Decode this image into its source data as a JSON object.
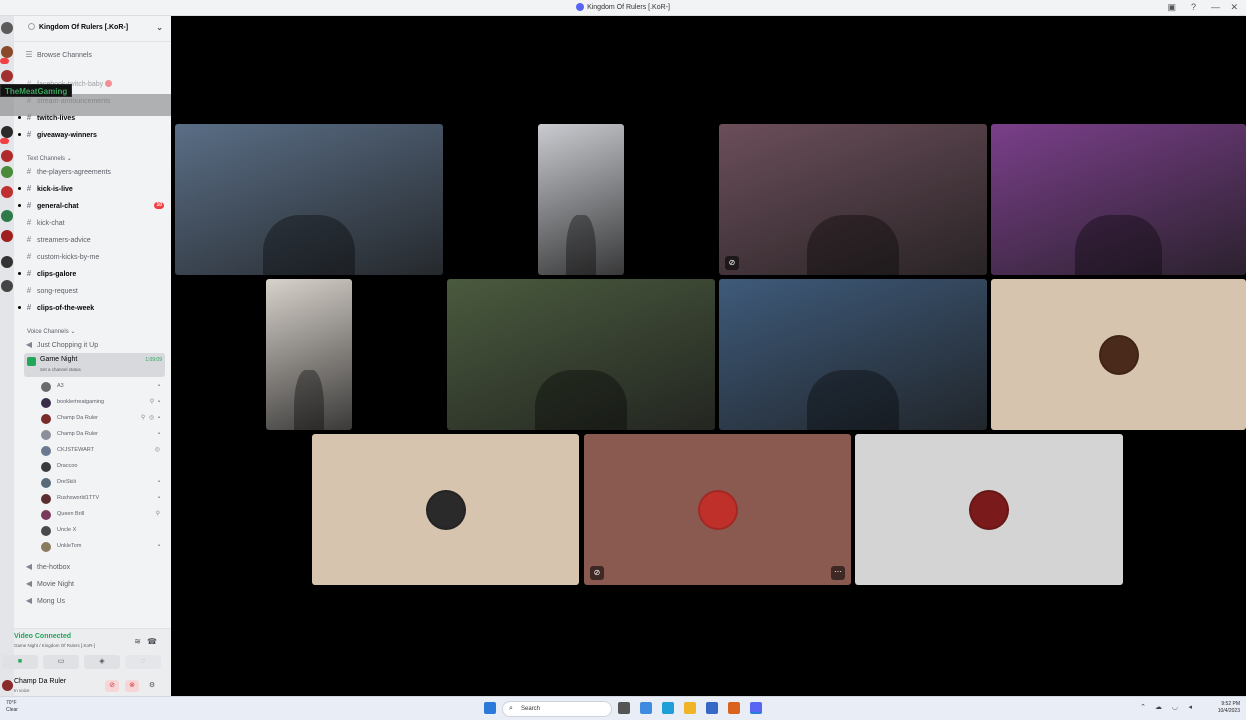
{
  "window": {
    "title": "Kingdom Of Rulers [.KoR-]"
  },
  "server": {
    "name": "Kingdom Of Rulers [.KoR-]"
  },
  "overlay": {
    "streamer_tag": "TheMeatGaming"
  },
  "sidebar": {
    "browse": "Browse Channels",
    "top_channels": [
      {
        "name": "facebook-twitch-baby",
        "bold": false
      },
      {
        "name": "stream-announcements",
        "bold": false
      },
      {
        "name": "twitch-lives",
        "bold": true
      },
      {
        "name": "giveaway-winners",
        "bold": true
      }
    ],
    "text_category": "Text Channels",
    "text_channels": [
      {
        "name": "the-players-agreements",
        "bold": false,
        "badge": ""
      },
      {
        "name": "kick-is-live",
        "bold": true,
        "badge": ""
      },
      {
        "name": "general-chat",
        "bold": true,
        "badge": "10"
      },
      {
        "name": "kick-chat",
        "bold": false,
        "badge": ""
      },
      {
        "name": "streamers-advice",
        "bold": false,
        "badge": ""
      },
      {
        "name": "custom-kicks-by-me",
        "bold": false,
        "badge": ""
      },
      {
        "name": "clips-galore",
        "bold": true,
        "badge": ""
      },
      {
        "name": "song-request",
        "bold": false,
        "badge": ""
      },
      {
        "name": "clips-of-the-week",
        "bold": true,
        "badge": ""
      }
    ],
    "voice_category": "Voice Channels",
    "voice_top": "Just Chopping it Up",
    "active_voice": {
      "name": "Game Night",
      "status": "Set a channel status",
      "time": "1:09:09"
    },
    "voice_users": [
      {
        "name": "A3",
        "color": "#6b6b6b",
        "tail": "▪"
      },
      {
        "name": "booklertreatgaming",
        "color": "#3a2f4a",
        "tail": "⚲ ▪"
      },
      {
        "name": "Champ Da Ruler",
        "color": "#7a2a2a",
        "tail": "⚲ ◎ ▪"
      },
      {
        "name": "Champ Da Ruler",
        "color": "#8a8f99",
        "tail": "▪"
      },
      {
        "name": "CKJSTEWART",
        "color": "#6b7a90",
        "tail": "◎"
      },
      {
        "name": "Draccoo",
        "color": "#3a3a3a",
        "tail": ""
      },
      {
        "name": "DreSkiii",
        "color": "#566a7a",
        "tail": "▪"
      },
      {
        "name": "Rushsworld1TTV",
        "color": "#5a2f2f",
        "tail": "▪"
      },
      {
        "name": "Queen Brill",
        "color": "#7a3a5a",
        "tail": "⚲"
      },
      {
        "name": "Uncle X",
        "color": "#4a4a4a",
        "tail": ""
      },
      {
        "name": "UnkleTom",
        "color": "#8a7a60",
        "tail": "▪"
      }
    ],
    "more_voice": [
      "the-hotbox",
      "Movie Night",
      "Mong Us"
    ]
  },
  "voice_panel": {
    "status": "Video Connected",
    "channel": "Game Night / Kingdom Of Rulers [.KoR-]"
  },
  "user_panel": {
    "name": "Champ Da Ruler",
    "status": "In voice"
  },
  "stage_tiles": [
    {
      "kind": "video",
      "color": "#5a6e86",
      "corner": "",
      "avatar": ""
    },
    {
      "kind": "video",
      "color": "#c9cbd0",
      "corner": "",
      "avatar": ""
    },
    {
      "kind": "video",
      "color": "#6b4e5a",
      "corner": "⊘",
      "avatar": ""
    },
    {
      "kind": "video",
      "color": "#7a3f8a",
      "corner": "",
      "avatar": ""
    },
    {
      "kind": "video",
      "color": "#d8d2cb",
      "corner": "",
      "avatar": ""
    },
    {
      "kind": "video",
      "color": "#4a5a3e",
      "corner": "",
      "avatar": ""
    },
    {
      "kind": "video",
      "color": "#3e5a7a",
      "corner": "",
      "avatar": ""
    },
    {
      "kind": "avatar",
      "color": "#d6c4ae",
      "corner": "",
      "avatar": "#4a2a1a"
    },
    {
      "kind": "avatar",
      "color": "#d6c4ae",
      "corner": "",
      "avatar": "#2a2a2a"
    },
    {
      "kind": "avatar",
      "color": "#8a5a50",
      "corner": "⊘",
      "avatar": "#c0302a",
      "more": "⋯"
    },
    {
      "kind": "avatar",
      "color": "#d4d4d4",
      "corner": "",
      "avatar": "#7a1a1a"
    }
  ],
  "taskbar": {
    "weather_temp": "70°F",
    "weather_desc": "Clear",
    "search": "Search",
    "time": "9:52 PM",
    "date": "10/4/2023"
  }
}
